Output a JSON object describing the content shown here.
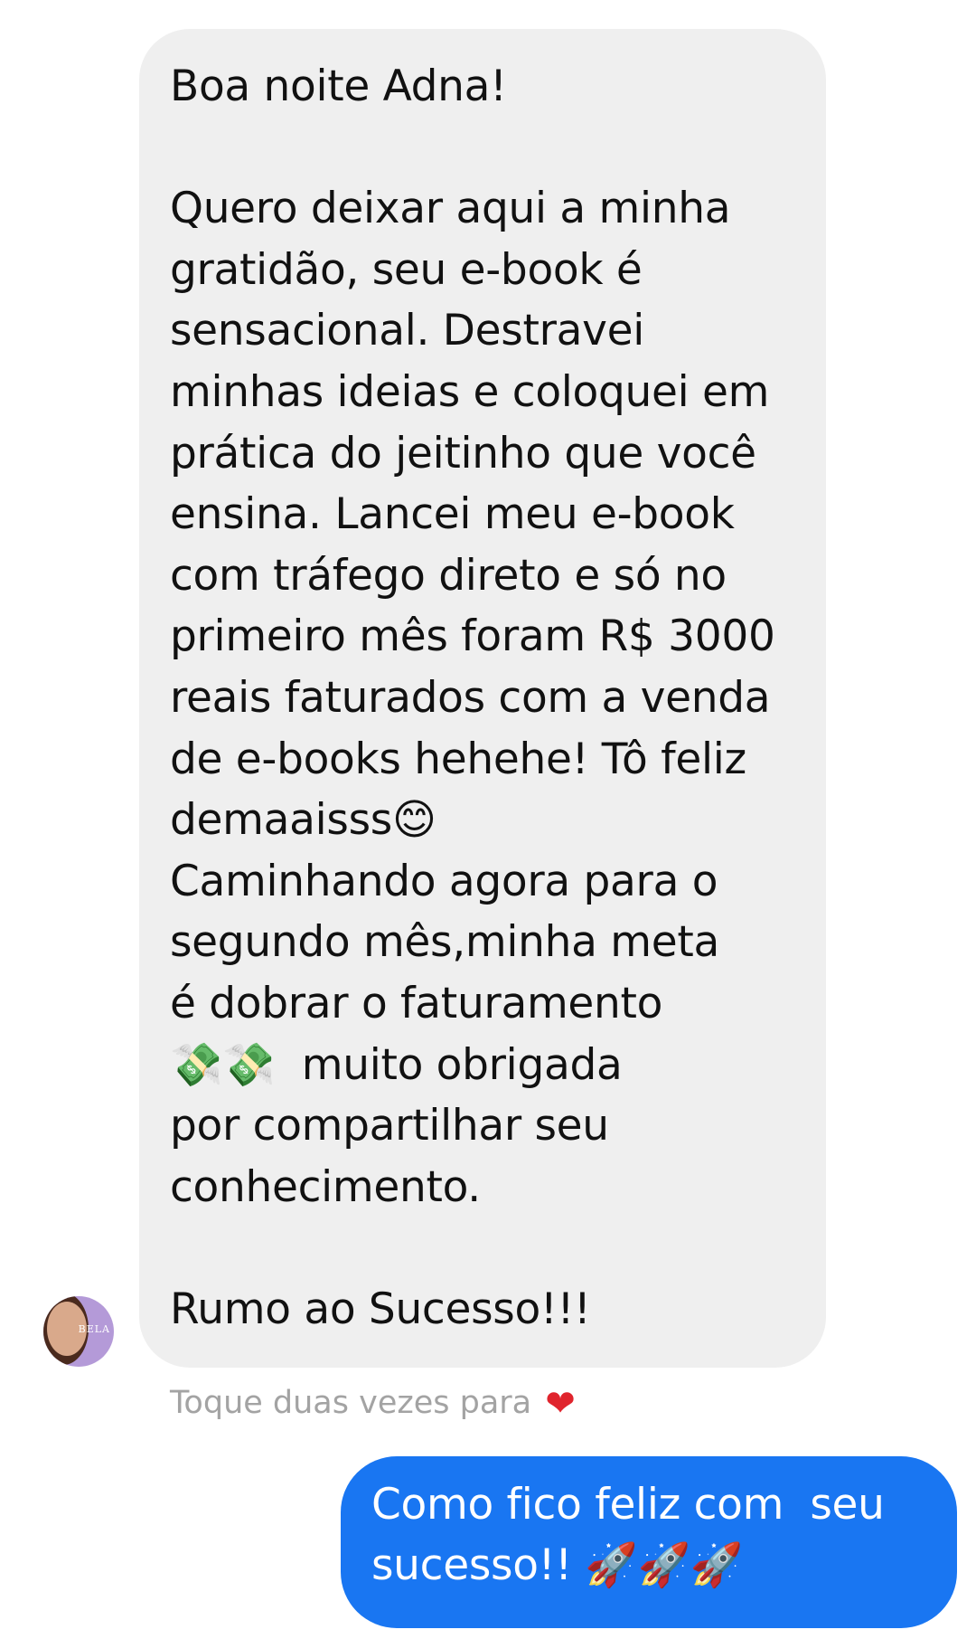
{
  "incoming_message": {
    "lines": [
      "Boa noite Adna!",
      "",
      "Quero deixar aqui a minha",
      "gratidão, seu e-book é",
      "sensacional. Destravei",
      "minhas ideias e coloquei em",
      "prática do jeitinho que você",
      "ensina. Lancei meu e-book",
      "com tráfego direto e só no",
      "primeiro mês foram R$ 3000",
      "reais faturados com a venda",
      "de e-books hehehe! Tô feliz",
      "demaaisss😊",
      "Caminhando agora para o",
      "segundo mês,minha meta",
      "é dobrar o faturamento",
      "💸💸  muito obrigada",
      "por compartilhar seu",
      "conhecimento.",
      "",
      "Rumo ao Sucesso!!!"
    ]
  },
  "sender": {
    "avatar_brand_text": "BELA"
  },
  "reaction_hint": {
    "text": "Toque duas vezes para",
    "icon": "heart-icon",
    "icon_glyph": "❤"
  },
  "outgoing_message": {
    "lines": [
      "Como fico feliz com  seu",
      "sucesso!! 🚀🚀🚀"
    ]
  },
  "colors": {
    "incoming_bubble": "#efefef",
    "outgoing_bubble": "#1976f2",
    "hint_text": "#a3a3a3",
    "heart": "#e0242d"
  }
}
